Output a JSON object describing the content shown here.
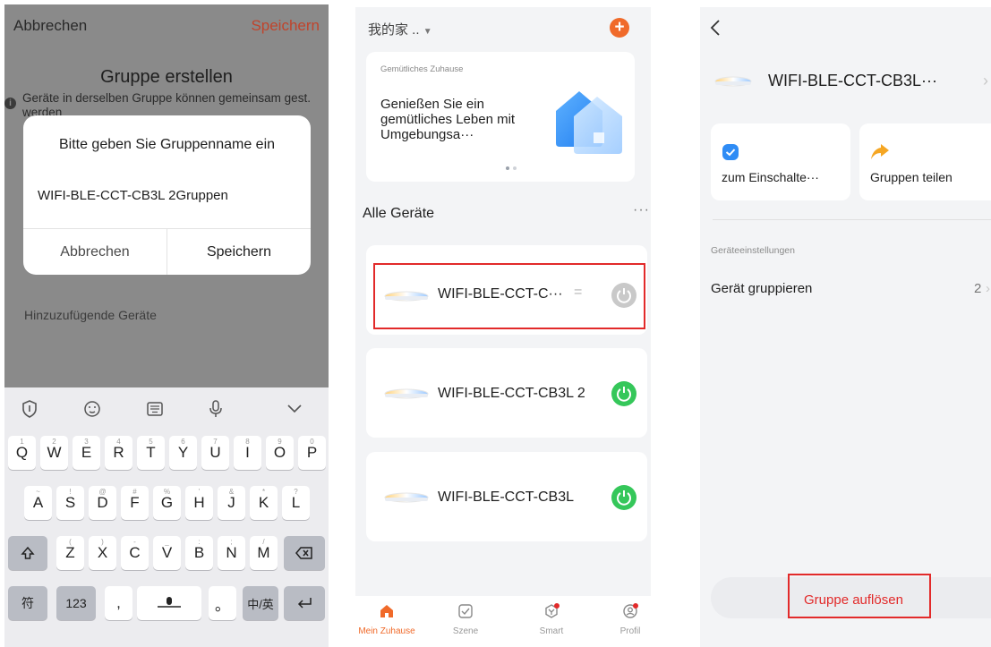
{
  "create_group": {
    "cancel_label": "Abbrechen",
    "save_label": "Speichern",
    "title": "Gruppe erstellen",
    "info_text": "Geräte in derselben Gruppe können gemeinsam gest. werden",
    "dialog": {
      "title": "Bitte geben Sie Gruppenname ein",
      "input_value": "WIFI-BLE-CCT-CB3L 2Gruppen",
      "cancel_label": "Abbrechen",
      "save_label": "Speichern"
    },
    "devices_label": "Hinzuzufügende Geräte",
    "keyboard": {
      "row1": [
        "Q",
        "W",
        "E",
        "R",
        "T",
        "Y",
        "U",
        "I",
        "O",
        "P"
      ],
      "row1_sub": [
        "1",
        "2",
        "3",
        "4",
        "5",
        "6",
        "7",
        "8",
        "9",
        "0"
      ],
      "row2": [
        "A",
        "S",
        "D",
        "F",
        "G",
        "H",
        "J",
        "K",
        "L"
      ],
      "row2_sub": [
        "~",
        "!",
        "@",
        "#",
        "%",
        "'",
        "&",
        "*",
        "?"
      ],
      "row3": [
        "Z",
        "X",
        "C",
        "V",
        "B",
        "N",
        "M"
      ],
      "row3_sub": [
        "(",
        ")",
        "-",
        "_",
        ":",
        ";",
        "/"
      ],
      "key_symbols": "符",
      "key_numbers": "123",
      "key_comma": ",",
      "key_period": "。",
      "key_lang": "中/英"
    }
  },
  "home": {
    "title": "我的家 ..",
    "banner": {
      "small": "Gemütliches Zuhause",
      "main": "Genießen Sie ein gemütliches Leben mit Umgebungsa···"
    },
    "section_title": "Alle Geräte",
    "more_label": "···",
    "devices": [
      {
        "name": "WIFI-BLE-CCT-C···",
        "state": "off"
      },
      {
        "name": "WIFI-BLE-CCT-CB3L 2",
        "state": "on"
      },
      {
        "name": "WIFI-BLE-CCT-CB3L",
        "state": "on"
      }
    ],
    "tabs": [
      {
        "label": "Mein Zuhause"
      },
      {
        "label": "Szene"
      },
      {
        "label": "Smart"
      },
      {
        "label": "Profil"
      }
    ],
    "colors": {
      "accent": "#f06a2a",
      "power_on": "#35c75a",
      "highlight": "#e22a2a"
    }
  },
  "group_detail": {
    "back_label": "<",
    "group_name": "WIFI-BLE-CCT-CB3L···",
    "cards": [
      {
        "label": "zum Einschalte···",
        "icon": "check-shield-icon"
      },
      {
        "label": "Gruppen teilen",
        "icon": "share-arrow-icon"
      }
    ],
    "settings_label": "Geräteeinstellungen",
    "row_label": "Gerät gruppieren",
    "row_value": "2",
    "dissolve_label": "Gruppe auflösen"
  }
}
